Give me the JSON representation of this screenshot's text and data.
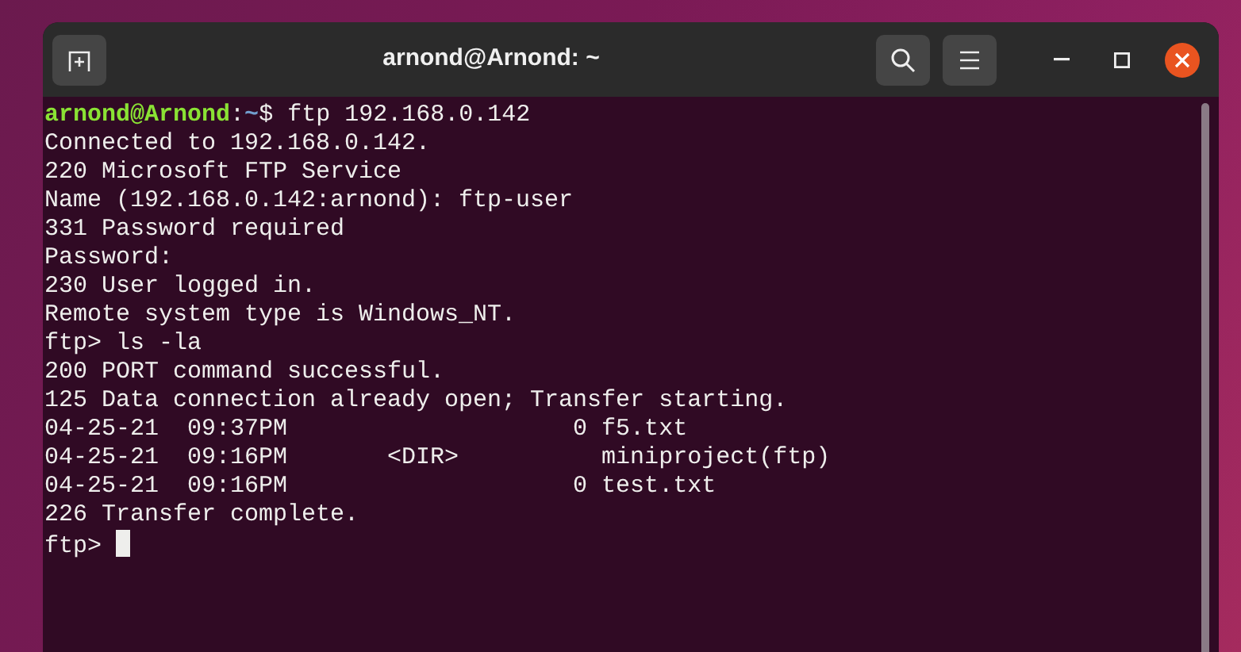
{
  "window": {
    "title": "arnond@Arnond: ~"
  },
  "terminal": {
    "lines": [
      {
        "kind": "prompt",
        "user_host": "arnond@Arnond",
        "separator": ":",
        "path": "~",
        "command": "$ ftp 192.168.0.142"
      },
      {
        "kind": "output",
        "text": "Connected to 192.168.0.142."
      },
      {
        "kind": "output",
        "text": "220 Microsoft FTP Service"
      },
      {
        "kind": "output",
        "text": "Name (192.168.0.142:arnond): ftp-user"
      },
      {
        "kind": "output",
        "text": "331 Password required"
      },
      {
        "kind": "output",
        "text": "Password:"
      },
      {
        "kind": "output",
        "text": "230 User logged in."
      },
      {
        "kind": "output",
        "text": "Remote system type is Windows_NT."
      },
      {
        "kind": "output",
        "text": "ftp> ls -la"
      },
      {
        "kind": "output",
        "text": "200 PORT command successful."
      },
      {
        "kind": "output",
        "text": "125 Data connection already open; Transfer starting."
      },
      {
        "kind": "output",
        "text": "04-25-21  09:37PM                    0 f5.txt"
      },
      {
        "kind": "output",
        "text": "04-25-21  09:16PM       <DIR>          miniproject(ftp)"
      },
      {
        "kind": "output",
        "text": "04-25-21  09:16PM                    0 test.txt"
      },
      {
        "kind": "output",
        "text": "226 Transfer complete."
      },
      {
        "kind": "input",
        "text": "ftp>",
        "cursor": true
      }
    ]
  }
}
